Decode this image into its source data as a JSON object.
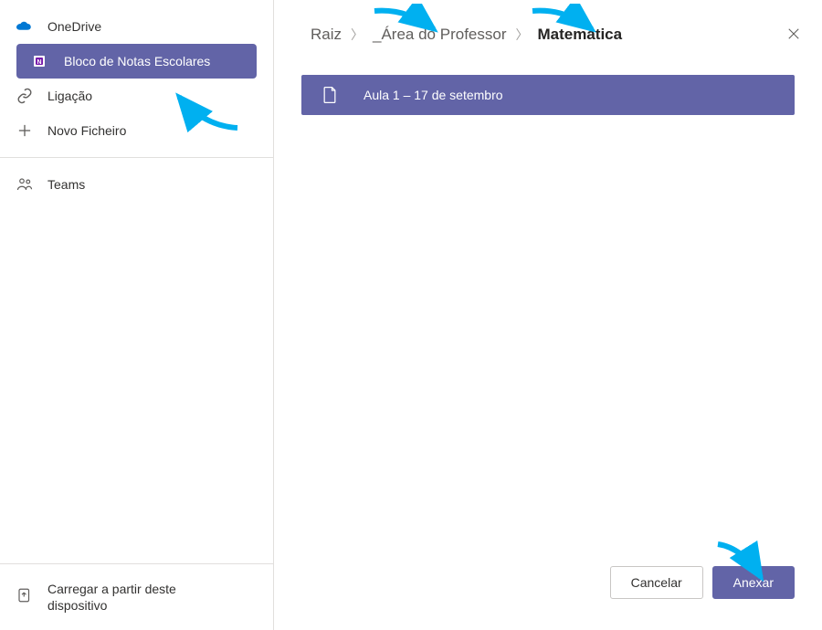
{
  "sidebar": {
    "items": [
      {
        "label": "OneDrive",
        "icon": "onedrive-icon",
        "active": false
      },
      {
        "label": "Bloco de Notas Escolares",
        "icon": "onenote-icon",
        "active": true
      },
      {
        "label": "Ligação",
        "icon": "link-icon",
        "active": false
      },
      {
        "label": "Novo Ficheiro",
        "icon": "plus-icon",
        "active": false
      }
    ],
    "teams_label": "Teams",
    "upload_label": "Carregar a partir deste dispositivo"
  },
  "breadcrumb": {
    "items": [
      {
        "label": "Raiz",
        "current": false
      },
      {
        "label": "_Área do Professor",
        "current": false
      },
      {
        "label": "Matemática",
        "current": true
      }
    ]
  },
  "file_list": [
    {
      "name": "Aula 1 – 17 de setembro"
    }
  ],
  "buttons": {
    "cancel": "Cancelar",
    "attach": "Anexar"
  },
  "colors": {
    "accent": "#6264a7",
    "annotation": "#00b0f0"
  }
}
